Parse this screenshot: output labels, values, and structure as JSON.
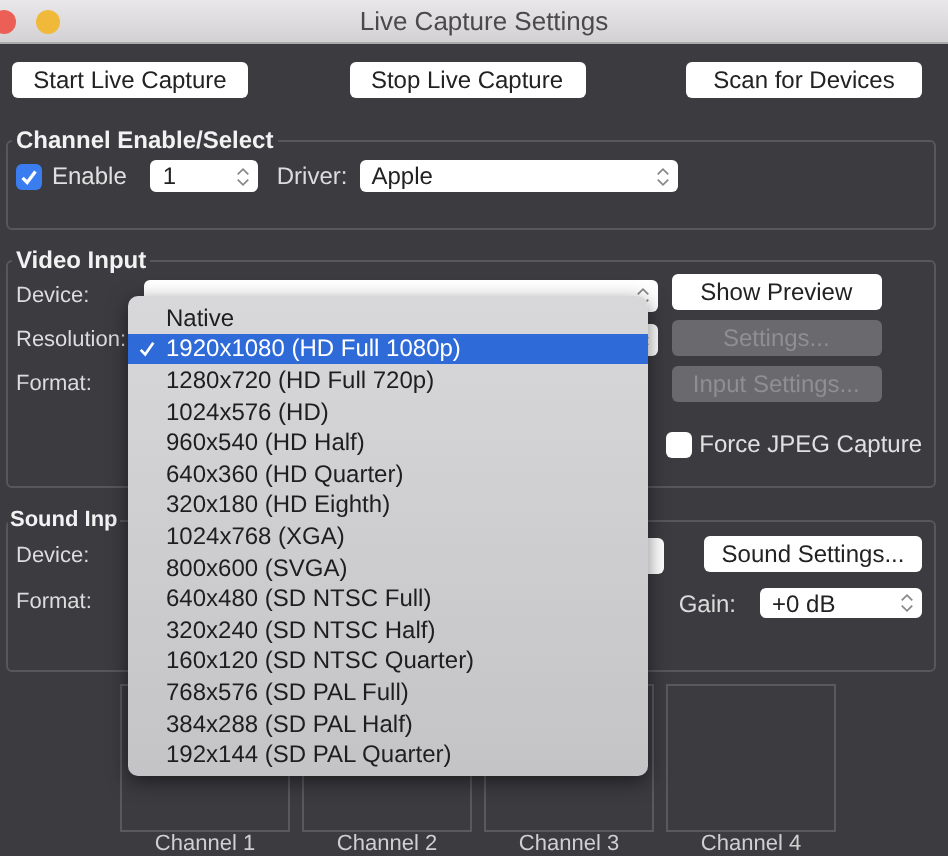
{
  "window": {
    "title": "Live Capture Settings"
  },
  "toolbar": [
    "Start Live Capture",
    "Stop Live Capture",
    "Scan for Devices"
  ],
  "channel_group": {
    "title": "Channel Enable/Select",
    "enable": {
      "label": "Enable",
      "checked": true
    },
    "channel": "1",
    "driver_label": "Driver:",
    "driver": "Apple"
  },
  "video_input": {
    "title": "Video Input",
    "labels": [
      "Device:",
      "Resolution:",
      "Format:"
    ],
    "buttons": [
      {
        "label": "Show Preview",
        "disabled": false
      },
      {
        "label": "Settings...",
        "disabled": true
      },
      {
        "label": "Input Settings...",
        "disabled": true
      }
    ],
    "force_jpeg": {
      "label": "Force JPEG Capture",
      "checked": false
    }
  },
  "resolution_menu": [
    {
      "label": "Native",
      "selected": false
    },
    {
      "label": "1920x1080 (HD Full 1080p)",
      "selected": true
    },
    {
      "label": "1280x720 (HD Full 720p)",
      "selected": false
    },
    {
      "label": "1024x576 (HD)",
      "selected": false
    },
    {
      "label": "960x540 (HD Half)",
      "selected": false
    },
    {
      "label": "640x360 (HD Quarter)",
      "selected": false
    },
    {
      "label": "320x180 (HD Eighth)",
      "selected": false
    },
    {
      "label": "1024x768 (XGA)",
      "selected": false
    },
    {
      "label": "800x600 (SVGA)",
      "selected": false
    },
    {
      "label": "640x480 (SD NTSC Full)",
      "selected": false
    },
    {
      "label": "320x240 (SD NTSC Half)",
      "selected": false
    },
    {
      "label": "160x120 (SD NTSC Quarter)",
      "selected": false
    },
    {
      "label": "768x576 (SD PAL Full)",
      "selected": false
    },
    {
      "label": "384x288 (SD PAL Half)",
      "selected": false
    },
    {
      "label": "192x144 (SD PAL Quarter)",
      "selected": false
    }
  ],
  "sound_input": {
    "title": "Sound Inp",
    "labels": [
      "Device:",
      "Format:"
    ],
    "button": "Sound Settings...",
    "gain_label": "Gain:",
    "gain": "+0 dB"
  },
  "channels": [
    "Channel 1",
    "Channel 2",
    "Channel 3",
    "Channel 4"
  ]
}
